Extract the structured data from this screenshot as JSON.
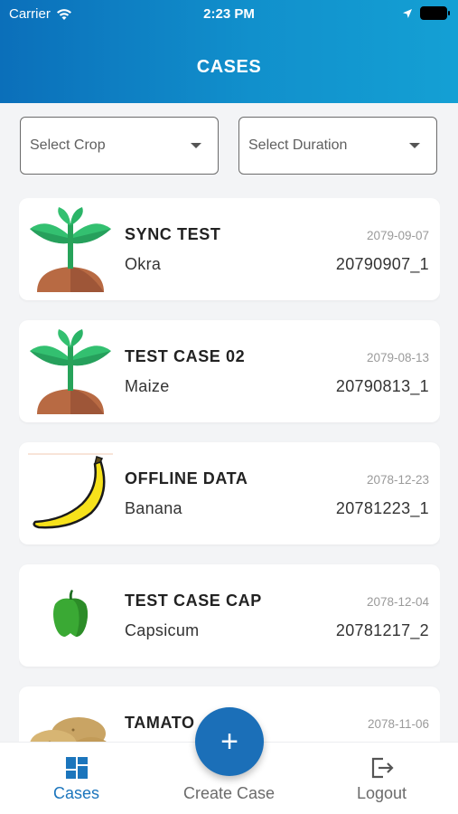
{
  "status": {
    "carrier": "Carrier",
    "time": "2:23 PM"
  },
  "header": {
    "title": "CASES"
  },
  "filters": {
    "crop_placeholder": "Select Crop",
    "duration_placeholder": "Select Duration"
  },
  "cases": [
    {
      "title": "SYNC TEST",
      "crop": "Okra",
      "date": "2079-09-07",
      "code": "20790907_1",
      "icon": "plant-icon"
    },
    {
      "title": "TEST CASE 02",
      "crop": "Maize",
      "date": "2079-08-13",
      "code": "20790813_1",
      "icon": "plant-icon"
    },
    {
      "title": "OFFLINE DATA",
      "crop": "Banana",
      "date": "2078-12-23",
      "code": "20781223_1",
      "icon": "banana-icon"
    },
    {
      "title": "TEST CASE CAP",
      "crop": "Capsicum",
      "date": "2078-12-04",
      "code": "20781217_2",
      "icon": "capsicum-icon"
    },
    {
      "title": "TAMATO",
      "crop": "",
      "date": "2078-11-06",
      "code": "",
      "icon": "potato-icon"
    }
  ],
  "tabs": {
    "cases": "Cases",
    "create": "Create Case",
    "logout": "Logout"
  },
  "fab": {
    "symbol": "+"
  },
  "colors": {
    "accent": "#1b75bc",
    "header_start": "#0b6fba",
    "header_end": "#14a0d4"
  }
}
